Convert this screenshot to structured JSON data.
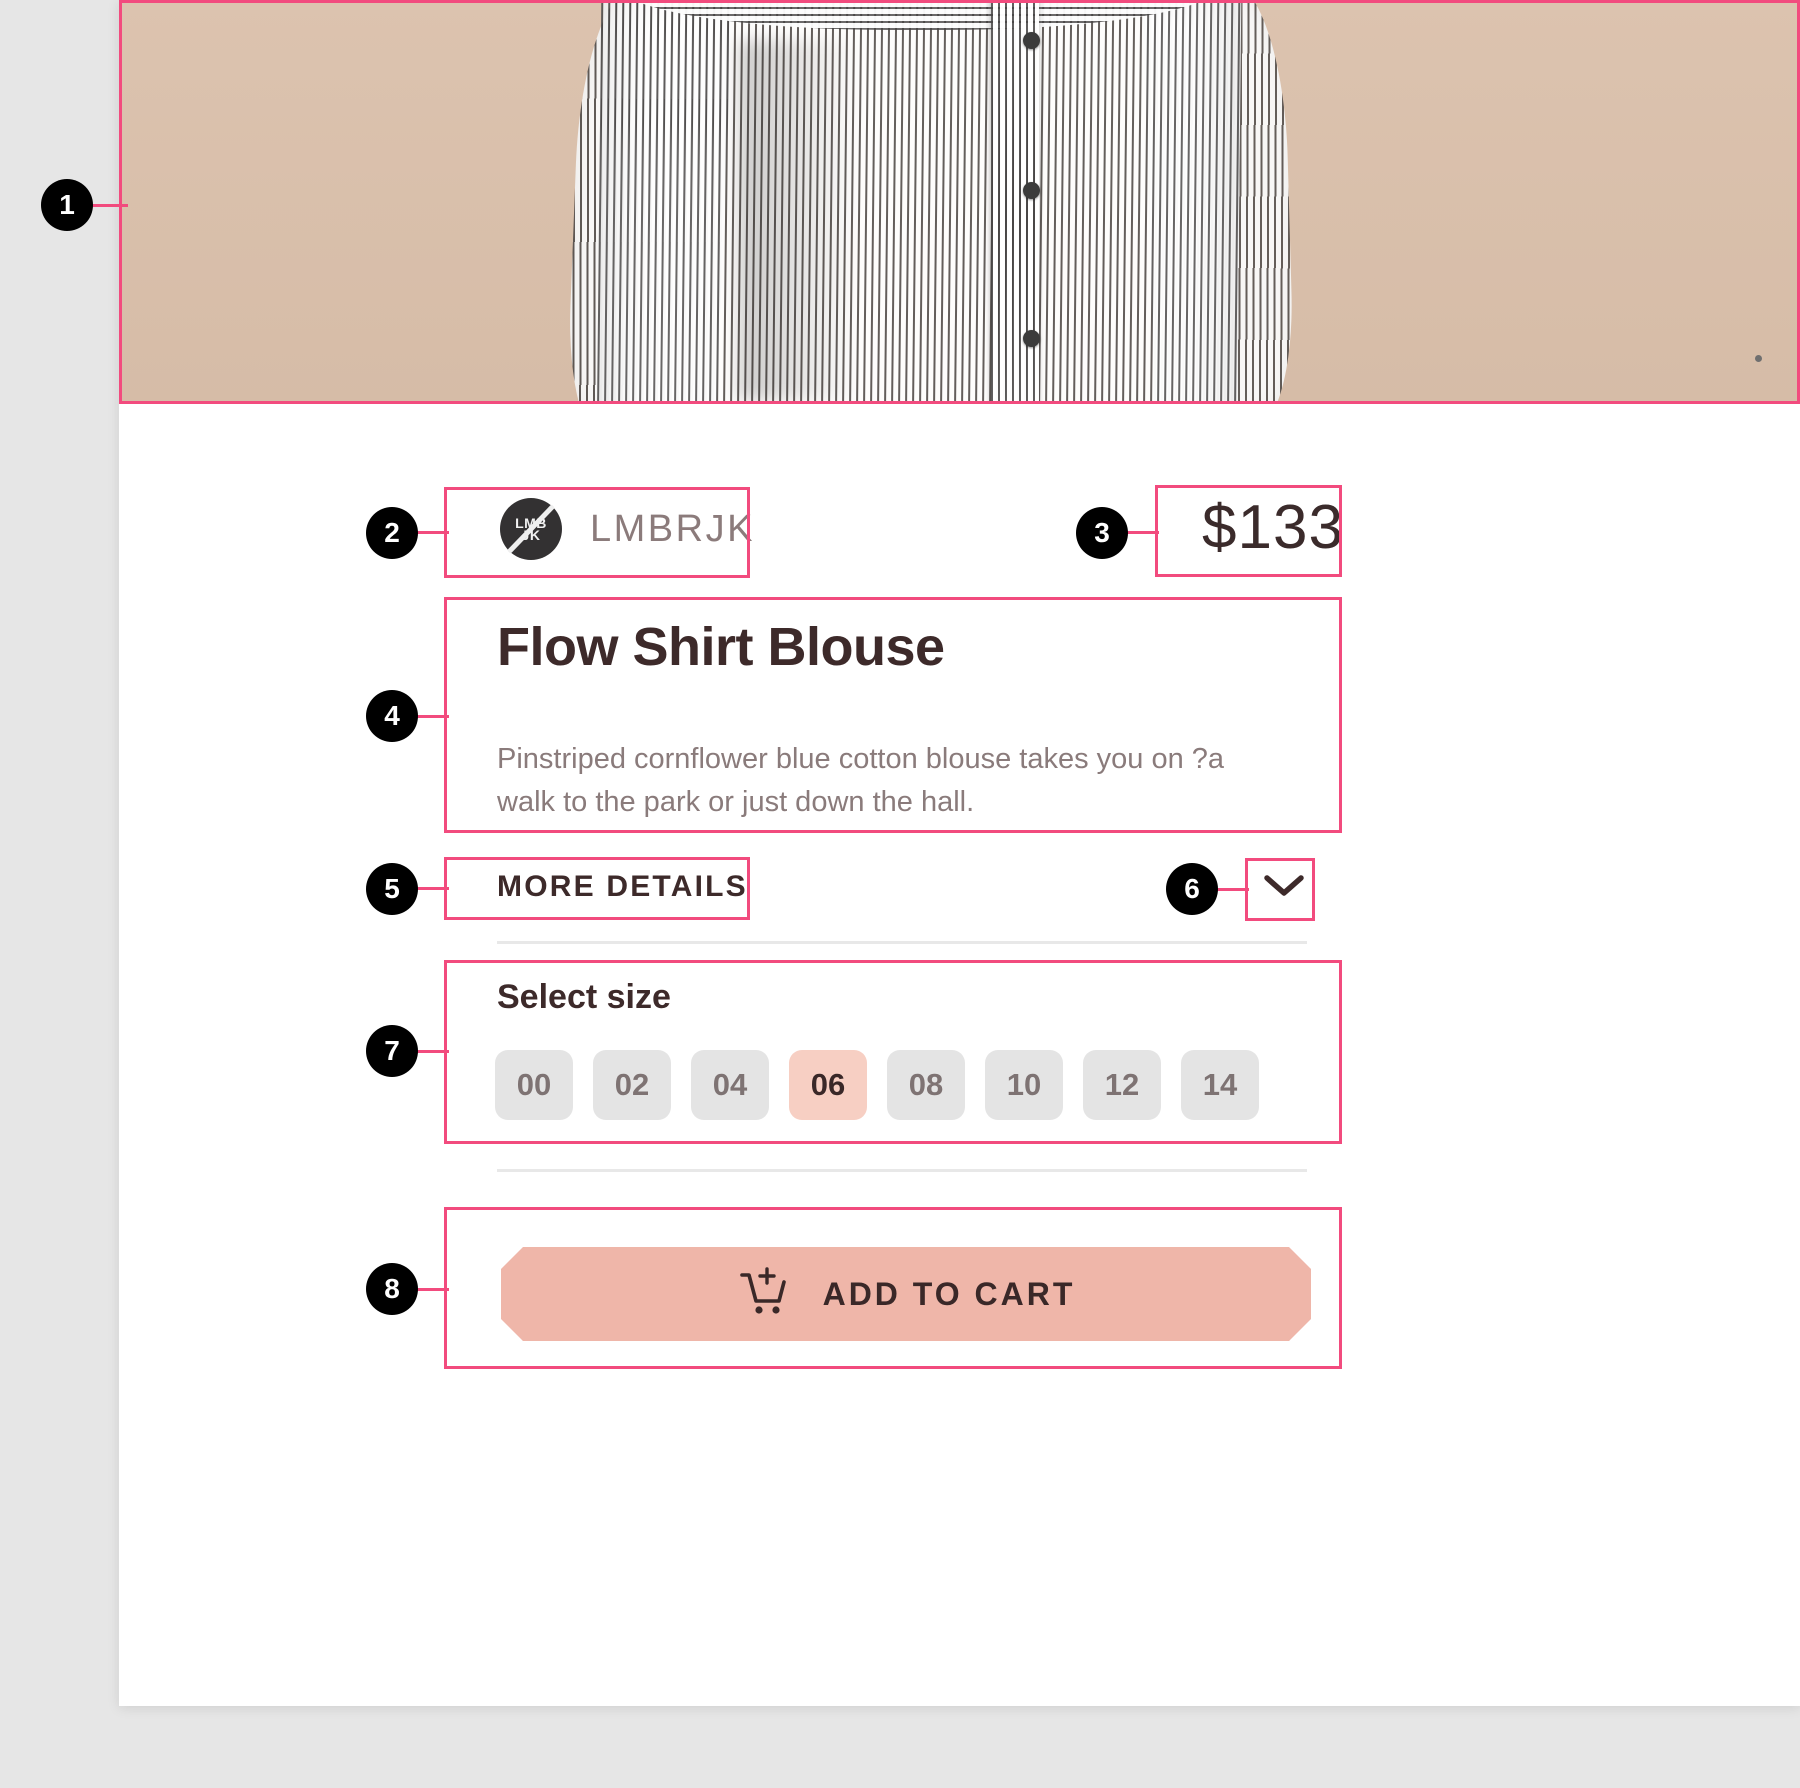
{
  "product": {
    "brand": "LMBRJK",
    "brand_logo_text": "LMB JK",
    "price": "$133",
    "title": "Flow Shirt Blouse",
    "description": "Pinstriped cornflower blue cotton blouse takes you on ?a walk to the park or just down the hall.",
    "more_details_label": "MORE DETAILS",
    "expand_icon": "chevron-down-icon",
    "size_section_label": "Select size",
    "sizes": [
      "00",
      "02",
      "04",
      "06",
      "08",
      "10",
      "12",
      "14"
    ],
    "selected_size": "06",
    "cart_button_label": "ADD TO CART",
    "cart_icon": "cart-plus-icon"
  },
  "colors": {
    "annotation": "#f24b7e",
    "badge_bg": "#000000",
    "accent": "#efb6a9",
    "selected_chip": "#f7cfc3",
    "chip": "#e4e4e4",
    "text_dark": "#3d2a2a",
    "text_muted": "#8a7b7b",
    "hero_bg": "#d9c0ac",
    "page_bg": "#e6e6e6"
  },
  "annotations": [
    {
      "id": "1",
      "number": "1",
      "target": "product-image"
    },
    {
      "id": "2",
      "number": "2",
      "target": "brand-row"
    },
    {
      "id": "3",
      "number": "3",
      "target": "price"
    },
    {
      "id": "4",
      "number": "4",
      "target": "title-and-description"
    },
    {
      "id": "5",
      "number": "5",
      "target": "more-details-label"
    },
    {
      "id": "6",
      "number": "6",
      "target": "expand-chevron"
    },
    {
      "id": "7",
      "number": "7",
      "target": "size-selector"
    },
    {
      "id": "8",
      "number": "8",
      "target": "add-to-cart"
    }
  ]
}
